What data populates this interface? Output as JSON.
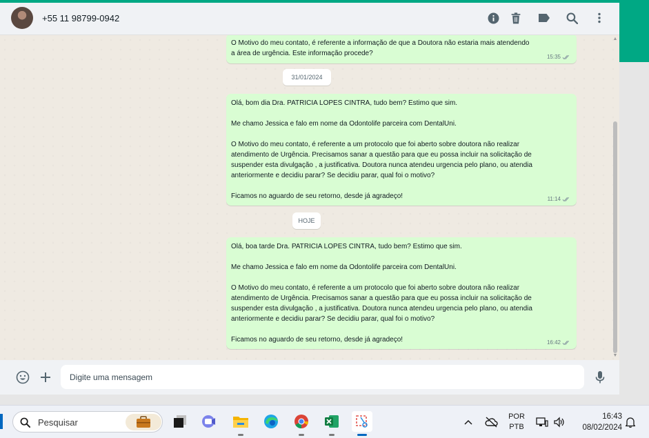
{
  "header": {
    "contact_name": "+55 11 98799-0942",
    "icons": [
      "info-icon",
      "trash-icon",
      "label-icon",
      "search-icon",
      "menu-icon"
    ]
  },
  "messages": [
    {
      "text": "O Motivo do meu contato, é referente a informação de que a Doutora não estaria mais atendendo\na área de urgência. Este informação procede?",
      "time": "15:35",
      "status": "read"
    },
    {
      "date_chip": "31/01/2024"
    },
    {
      "text": "Olá, bom dia Dra. PATRICIA LOPES CINTRA, tudo bem? Estimo que sim.\n\nMe chamo Jessica e falo em nome da Odontolife parceira com DentalUni.\n\nO Motivo do meu contato, é referente a um protocolo que foi aberto sobre doutora não realizar\natendimento de Urgência. Precisamos sanar a questão para que eu possa incluir na solicitação de\nsuspender esta divulgação , a justificativa. Doutora nunca atendeu urgencia pelo plano, ou atendia\nanteriormente e decidiu parar? Se decidiu parar, qual foi o motivo?\n\nFicamos no aguardo de seu retorno, desde já agradeço!",
      "time": "11:14",
      "status": "read"
    },
    {
      "date_chip": "HOJE"
    },
    {
      "text": "Olá, boa tarde Dra. PATRICIA LOPES CINTRA, tudo bem? Estimo que sim.\n\nMe chamo Jessica e falo em nome da Odontolife parceira com DentalUni.\n\nO Motivo do meu contato, é referente a um protocolo que foi aberto sobre doutora não realizar\natendimento de Urgência. Precisamos sanar a questão para que eu possa incluir na solicitação de\nsuspender esta divulgação , a justificativa. Doutora nunca atendeu urgencia pelo plano, ou atendia\nanteriormente e decidiu parar? Se decidiu parar, qual foi o motivo?\n\nFicamos no aguardo de seu retorno, desde já agradeço!",
      "time": "16:42",
      "status": "read"
    }
  ],
  "composer": {
    "placeholder": "Digite uma mensagem",
    "value": ""
  },
  "taskbar": {
    "search_label": "Pesquisar",
    "apps": [
      "work-widget-icon",
      "terminal-icon",
      "teams-icon",
      "file-explorer-icon",
      "edge-icon",
      "chrome-icon",
      "excel-icon",
      "snipping-tool-icon"
    ],
    "language_top": "POR",
    "language_bottom": "PTB",
    "time": "16:43",
    "date": "08/02/2024"
  },
  "colors": {
    "accent": "#00a884",
    "outgoing_bubble": "#d9fdd3",
    "chat_background": "#efeae2",
    "read_ticks": "#8696a0"
  }
}
